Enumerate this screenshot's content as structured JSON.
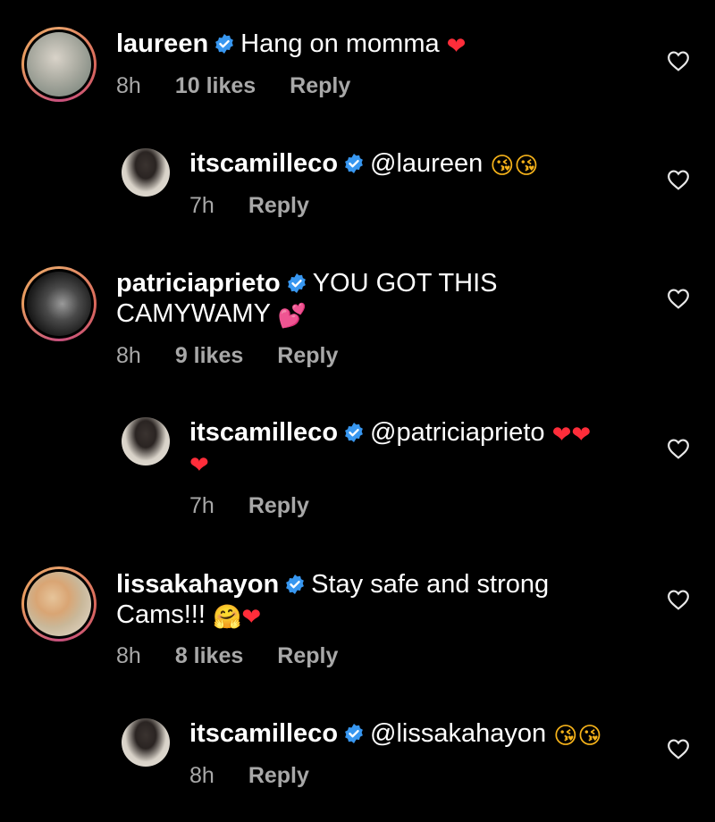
{
  "comments": [
    {
      "username": "laureen",
      "text": "Hang on momma",
      "emojis": [
        "❤"
      ],
      "time": "8h",
      "likes": "10 likes",
      "reply": "Reply"
    },
    {
      "username": "itscamilleco",
      "text": "@laureen",
      "emojis": [
        "😘",
        "😘"
      ],
      "time": "7h",
      "reply": "Reply"
    },
    {
      "username": "patriciaprieto",
      "text": "YOU GOT THIS CAMYWAMY",
      "emojis": [
        "💕"
      ],
      "time": "8h",
      "likes": "9 likes",
      "reply": "Reply"
    },
    {
      "username": "itscamilleco",
      "text": "@patriciaprieto",
      "emojis": [
        "❤",
        "❤",
        "❤"
      ],
      "time": "7h",
      "reply": "Reply"
    },
    {
      "username": "lissakahayon",
      "text": "Stay safe and strong Cams!!!",
      "emojis": [
        "🤗",
        "❤"
      ],
      "time": "8h",
      "likes": "8 likes",
      "reply": "Reply"
    },
    {
      "username": "itscamilleco",
      "text": "@lissakahayon",
      "emojis": [
        "😘",
        "😘"
      ],
      "time": "8h",
      "reply": "Reply"
    }
  ],
  "icons": {
    "verified": "verified-badge-icon",
    "like": "heart-outline-icon"
  },
  "colors": {
    "background": "#000000",
    "verified": "#3897f0",
    "meta": "#a8a8a8",
    "story_ring": "#d9685c"
  }
}
